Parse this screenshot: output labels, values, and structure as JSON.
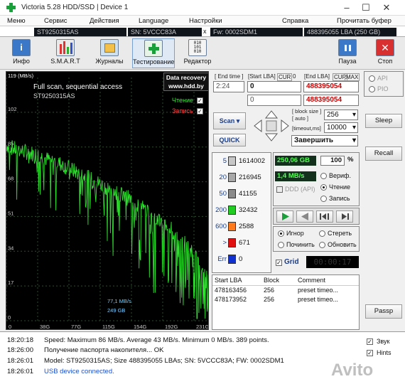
{
  "titlebar": {
    "title": "Victoria 5.28 HDD/SSD | Device 1",
    "minimize": "–",
    "maximize": "☐",
    "close": "✕"
  },
  "menu": [
    "Меню",
    "Сервис",
    "Действия",
    "Language",
    "Настройки",
    "Справка",
    "Прочитать буфер"
  ],
  "info": {
    "model": "ST9250315AS",
    "sn": "SN: 5VCCC83A",
    "close_x": "x",
    "fw": "Fw: 0002SDM1",
    "lba": "488395055 LBA (250 GB)"
  },
  "toolbar": [
    {
      "label": "Инфо",
      "icon": "info-icon"
    },
    {
      "label": "S.M.A.R.T",
      "icon": "smart-icon"
    },
    {
      "label": "Журналы",
      "icon": "journal-icon"
    },
    {
      "label": "Тестирование",
      "icon": "test-icon"
    },
    {
      "label": "Редактор",
      "icon": "editor-icon"
    },
    {
      "label": "Пауза",
      "icon": "pause-icon"
    },
    {
      "label": "Стоп",
      "icon": "stop-icon"
    }
  ],
  "graph": {
    "y_top": "119 (MB/s)",
    "scan_title": "Full scan, sequential access",
    "model": "ST9250315AS",
    "recovery": [
      "Data recovery",
      "www.hdd.by"
    ],
    "read_label": "Чтение",
    "write_label": "Запись",
    "speed_cur": "77,1 MB/s",
    "pos_cur": "249 GB"
  },
  "chart_data": {
    "type": "line",
    "title": "Full scan, sequential access",
    "ylabel": "MB/s",
    "ylim": [
      0,
      119
    ],
    "yticks": [
      102,
      85,
      68,
      51,
      34,
      17,
      0
    ],
    "xticks": [
      "0",
      "38G",
      "77G",
      "115G",
      "154G",
      "192G",
      "231G"
    ],
    "series": [
      {
        "name": "Чтение",
        "x_gb": [
          0,
          10,
          20,
          30,
          40,
          50,
          60,
          70,
          80,
          90,
          100,
          110,
          120,
          130,
          140,
          150,
          160,
          170,
          180,
          190,
          200,
          210,
          220,
          230,
          240,
          249
        ],
        "values": [
          86,
          84,
          83,
          82,
          81,
          79,
          78,
          76,
          74,
          72,
          70,
          68,
          66,
          64,
          62,
          60,
          57,
          55,
          52,
          49,
          46,
          42,
          38,
          33,
          28,
          20
        ]
      }
    ]
  },
  "lba": {
    "end_time_label": "[ End time ]",
    "end_time": "2:24",
    "start_label": "[Start LBA]",
    "cur_label": "CUR",
    "cur_val": "0",
    "end_label": "[End LBA]",
    "cur2_label": "CUR",
    "max_label": "MAX",
    "start_val": "0",
    "start_val2": "0",
    "end_val": "488395054",
    "end_val2": "488395054"
  },
  "scan": {
    "scan_btn": "Scan",
    "quick_btn": "QUICK",
    "block_size_label": "[ block size ]",
    "auto_label": "[ auto ]",
    "block_size": "256",
    "timeout_label": "[timeout,ms]",
    "timeout": "10000",
    "finish": "Завершить"
  },
  "stats": {
    "counts": [
      {
        "ms": "5",
        "count": "1614002",
        "color": "#c7c7c7"
      },
      {
        "ms": "20",
        "count": "216945",
        "color": "#a8a8a8"
      },
      {
        "ms": "50",
        "count": "41155",
        "color": "#8a8a8a"
      },
      {
        "ms": "200",
        "count": "32432",
        "color": "#22cc22"
      },
      {
        "ms": "600",
        "count": "2588",
        "color": "#ff7a1a"
      },
      {
        "ms": ">",
        "count": "671",
        "color": "#e01010"
      },
      {
        "ms": "Err",
        "count": "0",
        "color": "#1030d0"
      }
    ],
    "done_gb": "250,06 GB",
    "percent": "100",
    "pct_sign": "%",
    "speed": "1,4 MB/s",
    "verify": "Вериф.",
    "read": "Чтение",
    "write": "Запись",
    "ddd": "DDD (API)",
    "ignore": "Игнор",
    "erase": "Стереть",
    "repair": "Починить",
    "refresh": "Обновить",
    "grid": "Grid",
    "timer": "00:00:17"
  },
  "table": {
    "headers": [
      "Start LBA",
      "Block",
      "Comment"
    ],
    "rows": [
      [
        "478163456",
        "256",
        "preset timeo..."
      ],
      [
        "478173952",
        "256",
        "preset timeo..."
      ]
    ]
  },
  "right": {
    "api": "API",
    "pio": "PIO",
    "sleep": "Sleep",
    "recall": "Recall",
    "passp": "Passp",
    "sound": "Звук",
    "hints": "Hints"
  },
  "log": [
    {
      "time": "18:20:18",
      "text": "Speed: Maximum 86 MB/s. Average 43 MB/s. Minimum 0 MB/s. 389 points.",
      "color": "#111"
    },
    {
      "time": "18:26:00",
      "text": "Получение паспорта накопителя... OK",
      "color": "#111"
    },
    {
      "time": "18:26:01",
      "text": "Model: ST9250315AS; Size 488395055 LBAs; SN: 5VCCC83A; FW: 0002SDM1",
      "color": "#111"
    },
    {
      "time": "18:26:01",
      "text": "USB device connected.",
      "color": "#1a4fd0"
    }
  ],
  "watermark": "Avito"
}
